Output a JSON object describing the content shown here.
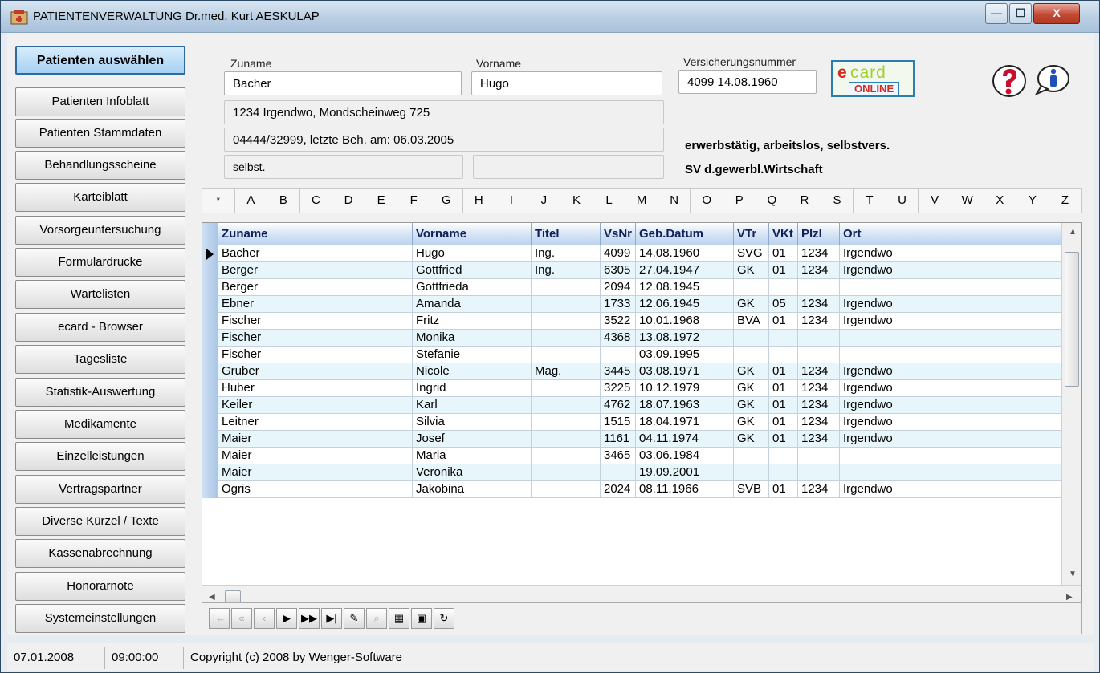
{
  "window": {
    "title": "PATIENTENVERWALTUNG   Dr.med. Kurt AESKULAP",
    "min_glyph": "—",
    "max_glyph": "☐",
    "close_glyph": "X"
  },
  "nav": {
    "items": [
      "Patienten auswählen",
      "Patienten Infoblatt",
      "Patienten Stammdaten",
      "Behandlungsscheine",
      "Karteiblatt",
      "Vorsorgeuntersuchung",
      "Formulardrucke",
      "Wartelisten",
      "ecard - Browser",
      "Tagesliste",
      "Statistik-Auswertung",
      "Medikamente",
      "Einzelleistungen",
      "Vertragspartner",
      "Diverse Kürzel / Texte",
      "Kassenabrechnung",
      "Honorarnote",
      "Systemeinstellungen"
    ],
    "active_index": 0
  },
  "patient": {
    "zuname_label": "Zuname",
    "zuname": "Bacher",
    "vorname_label": "Vorname",
    "vorname": "Hugo",
    "vsnr_label": "Versicherungsnummer",
    "vsnr": "4099 14.08.1960",
    "address": "1234  Irgendwo,  Mondscheinweg 725",
    "phone_last": "04444/32999,   letzte Beh. am: 06.03.2005",
    "insured": "selbst.",
    "insured2": "",
    "status1": "erwerbstätig, arbeitslos, selbstvers.",
    "status2": "SV d.gewerbl.Wirtschaft"
  },
  "ecard": {
    "word_e": "e",
    "word_card": "card",
    "online": "ONLINE"
  },
  "alphabet": [
    "*",
    "A",
    "B",
    "C",
    "D",
    "E",
    "F",
    "G",
    "H",
    "I",
    "J",
    "K",
    "L",
    "M",
    "N",
    "O",
    "P",
    "Q",
    "R",
    "S",
    "T",
    "U",
    "V",
    "W",
    "X",
    "Y",
    "Z"
  ],
  "table": {
    "columns": [
      "Zuname",
      "Vorname",
      "Titel",
      "VsNr",
      "Geb.Datum",
      "VTr",
      "VKt",
      "Plzl",
      "Ort"
    ],
    "rows": [
      [
        "Bacher",
        "Hugo",
        "Ing.",
        "4099",
        "14.08.1960",
        "SVG",
        "01",
        "1234",
        "Irgendwo"
      ],
      [
        "Berger",
        "Gottfried",
        "Ing.",
        "6305",
        "27.04.1947",
        "GK",
        "01",
        "1234",
        "Irgendwo"
      ],
      [
        "Berger",
        "Gottfrieda",
        "",
        "2094",
        "12.08.1945",
        "",
        "",
        "",
        ""
      ],
      [
        "Ebner",
        "Amanda",
        "",
        "1733",
        "12.06.1945",
        "GK",
        "05",
        "1234",
        "Irgendwo"
      ],
      [
        "Fischer",
        "Fritz",
        "",
        "3522",
        "10.01.1968",
        "BVA",
        "01",
        "1234",
        "Irgendwo"
      ],
      [
        "Fischer",
        "Monika",
        "",
        "4368",
        "13.08.1972",
        "",
        "",
        "",
        ""
      ],
      [
        "Fischer",
        "Stefanie",
        "",
        "",
        "03.09.1995",
        "",
        "",
        "",
        ""
      ],
      [
        "Gruber",
        "Nicole",
        "Mag.",
        "3445",
        "03.08.1971",
        "GK",
        "01",
        "1234",
        "Irgendwo"
      ],
      [
        "Huber",
        "Ingrid",
        "",
        "3225",
        "10.12.1979",
        "GK",
        "01",
        "1234",
        "Irgendwo"
      ],
      [
        "Keiler",
        "Karl",
        "",
        "4762",
        "18.07.1963",
        "GK",
        "01",
        "1234",
        "Irgendwo"
      ],
      [
        "Leitner",
        "Silvia",
        "",
        "1515",
        "18.04.1971",
        "GK",
        "01",
        "1234",
        "Irgendwo"
      ],
      [
        "Maier",
        "Josef",
        "",
        "1161",
        "04.11.1974",
        "GK",
        "01",
        "1234",
        "Irgendwo"
      ],
      [
        "Maier",
        "Maria",
        "",
        "3465",
        "03.06.1984",
        "",
        "",
        "",
        ""
      ],
      [
        "Maier",
        "Veronika",
        "",
        "",
        "19.09.2001",
        "",
        "",
        "",
        ""
      ],
      [
        "Ogris",
        "Jakobina",
        "",
        "2024",
        "08.11.1966",
        "SVB",
        "01",
        "1234",
        "Irgendwo"
      ]
    ],
    "selected_row": 0
  },
  "navigator": {
    "buttons": [
      {
        "name": "first-record-button",
        "glyph": "|←",
        "enabled": false
      },
      {
        "name": "prior-page-button",
        "glyph": "«",
        "enabled": false
      },
      {
        "name": "prior-record-button",
        "glyph": "‹",
        "enabled": false
      },
      {
        "name": "next-record-button",
        "glyph": "▶",
        "enabled": true
      },
      {
        "name": "next-page-button",
        "glyph": "▶▶",
        "enabled": true
      },
      {
        "name": "last-record-button",
        "glyph": "▶|",
        "enabled": true
      },
      {
        "name": "edit-button",
        "glyph": "✎",
        "enabled": true
      },
      {
        "name": "goto-button",
        "glyph": "⌕",
        "enabled": false
      },
      {
        "name": "filter-button",
        "glyph": "▦",
        "enabled": true
      },
      {
        "name": "print-button",
        "glyph": "▣",
        "enabled": true
      },
      {
        "name": "refresh-button",
        "glyph": "↻",
        "enabled": true
      }
    ]
  },
  "status": {
    "date": "07.01.2008",
    "time": "09:00:00",
    "copyright": "Copyright (c) 2008 by Wenger-Software"
  },
  "colors": {
    "accent": "#2c6aa0",
    "row_alt": "#e7f6fb",
    "header_text": "#10205a",
    "ecard_red": "#d62a1e",
    "ecard_green": "#9fd12a"
  }
}
